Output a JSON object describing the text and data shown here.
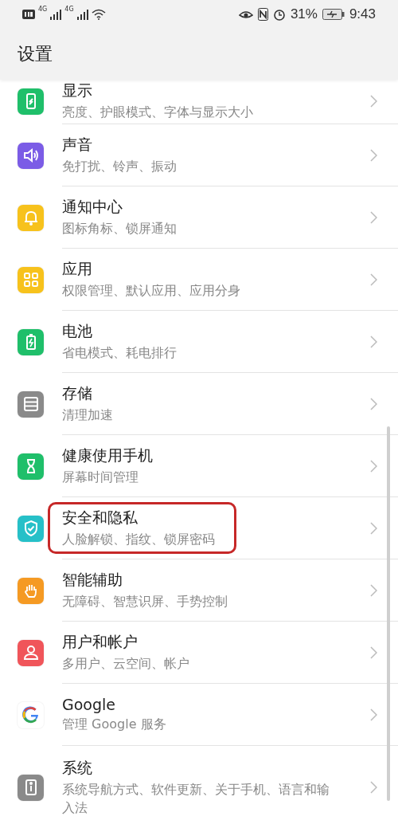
{
  "status_bar": {
    "network_labels": [
      "4G",
      "4G"
    ],
    "battery": "31%",
    "time": "9:43"
  },
  "header": {
    "title": "设置"
  },
  "items": [
    {
      "title": "显示",
      "subtitle": "亮度、护眼模式、字体与显示大小",
      "kind": "display",
      "color": "#1fbf6a",
      "highlighted": false
    },
    {
      "title": "声音",
      "subtitle": "免打扰、铃声、振动",
      "kind": "sound",
      "color": "#7b5ce6",
      "highlighted": false
    },
    {
      "title": "通知中心",
      "subtitle": "图标角标、锁屏通知",
      "kind": "bell",
      "color": "#f7c21c",
      "highlighted": false
    },
    {
      "title": "应用",
      "subtitle": "权限管理、默认应用、应用分身",
      "kind": "apps",
      "color": "#f7c21c",
      "highlighted": false
    },
    {
      "title": "电池",
      "subtitle": "省电模式、耗电排行",
      "kind": "battery",
      "color": "#1fbf6a",
      "highlighted": false
    },
    {
      "title": "存储",
      "subtitle": "清理加速",
      "kind": "storage",
      "color": "#8a8a8a",
      "highlighted": false
    },
    {
      "title": "健康使用手机",
      "subtitle": "屏幕时间管理",
      "kind": "hourglass",
      "color": "#1fbf6a",
      "highlighted": false
    },
    {
      "title": "安全和隐私",
      "subtitle": "人脸解锁、指纹、锁屏密码",
      "kind": "shield",
      "color": "#26c0c8",
      "highlighted": true
    },
    {
      "title": "智能辅助",
      "subtitle": "无障碍、智慧识屏、手势控制",
      "kind": "hand",
      "color": "#f59a23",
      "highlighted": false
    },
    {
      "title": "用户和帐户",
      "subtitle": "多用户、云空间、帐户",
      "kind": "user",
      "color": "#f0555a",
      "highlighted": false
    },
    {
      "title": "Google",
      "subtitle": "管理 Google 服务",
      "kind": "google",
      "color": "#ffffff",
      "highlighted": false
    },
    {
      "title": "系统",
      "subtitle": "系统导航方式、软件更新、关于手机、语言和输入法",
      "kind": "info",
      "color": "#8a8a8a",
      "highlighted": false
    }
  ]
}
